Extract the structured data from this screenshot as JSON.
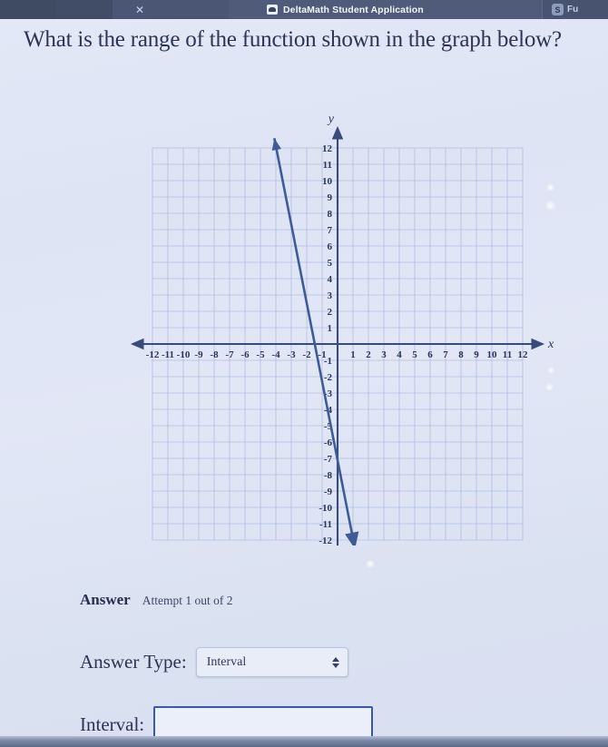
{
  "browser": {
    "close_icon": "close-icon",
    "favicon_name": "deltamath-favicon",
    "tab_title": "DeltaMath Student Application",
    "right_badge": "S",
    "right_label": "Fu"
  },
  "question": {
    "text": "What is the range of the function shown in the graph below?"
  },
  "chart_data": {
    "type": "line",
    "title": "",
    "xlabel": "x",
    "ylabel": "y",
    "xlim": [
      -12,
      12
    ],
    "ylim": [
      -12,
      12
    ],
    "grid": true,
    "legend": false,
    "x_ticks": [
      -12,
      -11,
      -10,
      -9,
      -8,
      -7,
      -6,
      -5,
      -4,
      -3,
      -2,
      -1,
      1,
      2,
      3,
      4,
      5,
      6,
      7,
      8,
      9,
      10,
      11,
      12
    ],
    "y_ticks": [
      12,
      11,
      10,
      9,
      8,
      7,
      6,
      5,
      4,
      3,
      2,
      1,
      -1,
      -2,
      -3,
      -4,
      -5,
      -6,
      -7,
      -8,
      -9,
      -10,
      -11,
      -12
    ],
    "x_tick_labels": [
      "-12",
      "-11",
      "-10",
      "-9",
      "-8",
      "-7",
      "-6",
      "-5",
      "-4",
      "-3",
      "-2",
      "-1",
      "1",
      "2",
      "3",
      "4",
      "5",
      "6",
      "7",
      "8",
      "9",
      "10",
      "11",
      "12"
    ],
    "y_tick_labels": [
      "12",
      "11",
      "10",
      "9",
      "8",
      "7",
      "6",
      "5",
      "4",
      "3",
      "2",
      "1",
      "-1",
      "-2",
      "-3",
      "-4",
      "-5",
      "-6",
      "-7",
      "-8",
      "-9",
      "-10",
      "-11",
      "-12"
    ],
    "series": [
      {
        "name": "line",
        "color": "#3f5a96",
        "arrows": "both",
        "x": [
          -4.1,
          1.1
        ],
        "y": [
          12.6,
          -12.4
        ],
        "y_intercept": -5.5,
        "slope": -4.8
      }
    ]
  },
  "answer": {
    "heading": "Answer",
    "attempt": "Attempt 1 out of 2",
    "type_label": "Answer Type:",
    "type_value": "Interval",
    "type_options": [
      "Interval"
    ],
    "interval_label": "Interval:",
    "interval_value": "",
    "interval_placeholder": ""
  },
  "colors": {
    "page_bg": "#dfe4f5",
    "chrome_bg": "#47536e",
    "line": "#3f5a96",
    "axis": "#3a4a79",
    "grid": "#9fb0d8",
    "input_border": "#3c57a8"
  }
}
